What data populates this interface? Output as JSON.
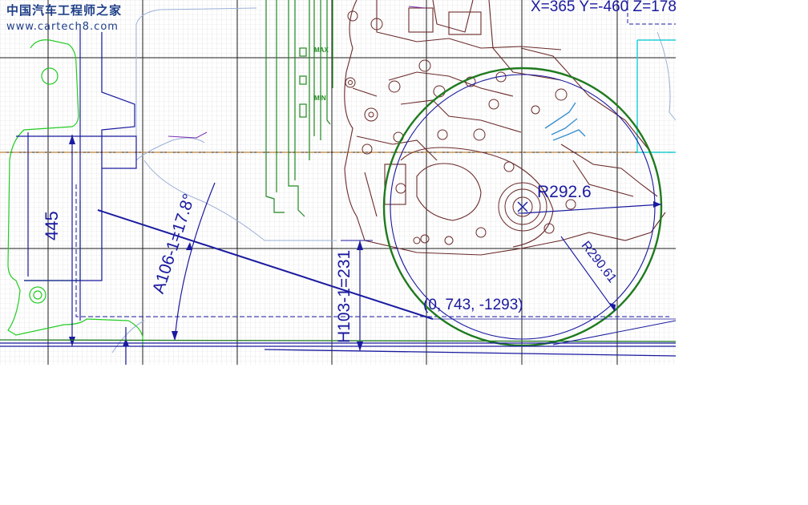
{
  "watermark": {
    "site_name": "中国汽车工程师之家",
    "url": "www.cartech8.com"
  },
  "coordinate_readout": "X=365 Y=-460 Z=178",
  "dimensions": {
    "vertical_length": "445",
    "angle": "A106-1=17.8°",
    "height": "H103-1=231",
    "radius_large": "R292.6",
    "radius_inner": "R290.61",
    "point": "(0, 743, -1293)"
  },
  "labels": {
    "max": "MAX",
    "min": "MIN"
  },
  "colors": {
    "grid_fine": "#d8d8d8",
    "grid_major": "#1c1c1c",
    "engine": "#6b2a2a",
    "circle": "#1f7a1f",
    "dimension": "#1a1aa0",
    "outline_green": "#22cc22",
    "centerline": "#c08030"
  }
}
